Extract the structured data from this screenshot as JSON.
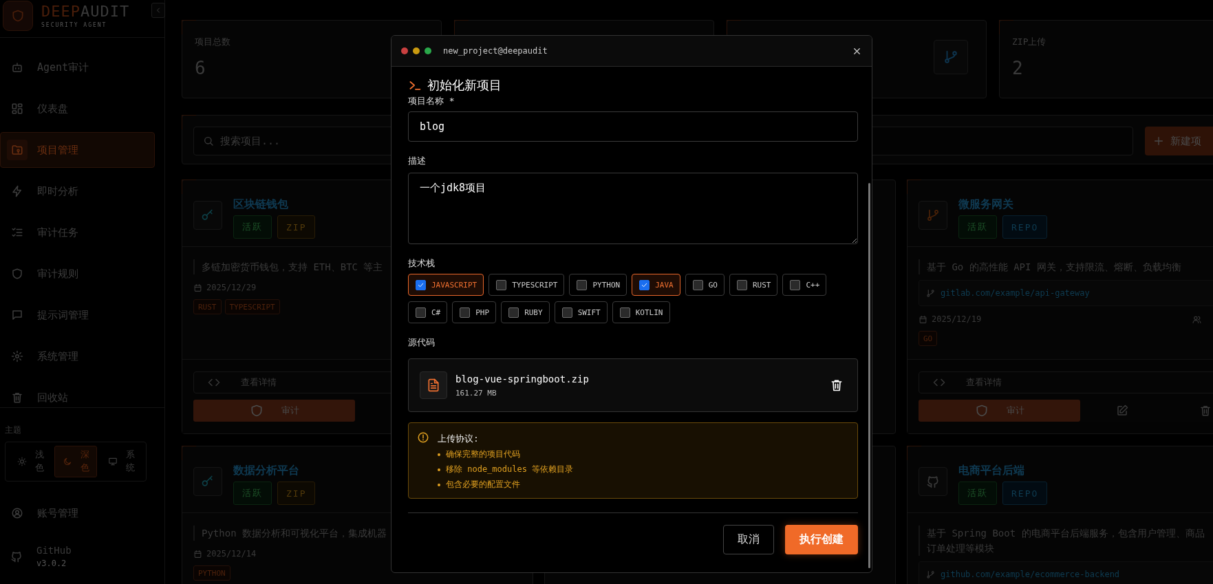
{
  "sidebar": {
    "brand_a": "DEEP",
    "brand_b": "AUDIT",
    "tagline": "SECURITY AGENT",
    "items": [
      {
        "label": "Agent审计",
        "selected": false
      },
      {
        "label": "仪表盘",
        "selected": false
      },
      {
        "label": "项目管理",
        "selected": true
      },
      {
        "label": "即时分析",
        "selected": false
      },
      {
        "label": "审计任务",
        "selected": false
      },
      {
        "label": "审计规则",
        "selected": false
      },
      {
        "label": "提示词管理",
        "selected": false
      },
      {
        "label": "系统管理",
        "selected": false
      },
      {
        "label": "回收站",
        "selected": false
      }
    ],
    "theme_label": "主题",
    "themes": [
      {
        "label": "浅色",
        "selected": false
      },
      {
        "label": "深色",
        "selected": true
      },
      {
        "label": "系统",
        "selected": false
      }
    ],
    "account": "账号管理",
    "github": "GitHub",
    "version": "v3.0.2"
  },
  "stats": [
    {
      "kind": "count",
      "label": "项目总数",
      "value": "6"
    },
    {
      "kind": "blank"
    },
    {
      "kind": "icon"
    },
    {
      "kind": "count",
      "label": "ZIP上传",
      "value": "2"
    }
  ],
  "search": {
    "placeholder": "搜索项目...",
    "button": "新建项"
  },
  "projects": [
    {
      "kind": "zip",
      "name": "区块链钱包",
      "status": "活跃",
      "type": "ZIP",
      "description_lines": [
        "多链加密货币钱包，支持 ETH、BTC 等主"
      ],
      "date": "2025/12/29",
      "tags": [
        "RUST",
        "TYPESCRIPT"
      ],
      "details": "查看详情",
      "audit": "审计"
    },
    {
      "kind": "covered"
    },
    {
      "kind": "repo",
      "name": "微服务网关",
      "status": "活跃",
      "type": "REPO",
      "description_lines": [
        "基于 Go 的高性能 API 网关，支持限流、熔断、负载均衡"
      ],
      "url": "gitlab.com/example/api-gateway",
      "date": "2025/12/19",
      "tags": [
        "GO"
      ],
      "details": "查看详情",
      "audit": "审计"
    },
    {
      "kind": "zip",
      "name": "数据分析平台",
      "status": "活跃",
      "type": "ZIP",
      "description_lines": [
        "Python 数据分析和可视化平台，集成机器"
      ],
      "date": "2025/12/14",
      "tags": [
        "PYTHON"
      ]
    },
    {
      "kind": "covered"
    },
    {
      "kind": "repo",
      "name": "电商平台后端",
      "status": "活跃",
      "type": "REPO",
      "description_lines": [
        "基于 Spring Boot 的电商平台后端服务，包含用户管理、商品",
        "订单处理等模块"
      ],
      "url": "github.com/example/ecommerce-backend"
    }
  ],
  "modal": {
    "title": "new_project@deepaudit",
    "heading": "初始化新项目",
    "name_label": "项目名称",
    "required_mark": "*",
    "name_value": "blog",
    "desc_label": "描述",
    "desc_value": "一个jdk8项目",
    "stack_label": "技术栈",
    "stack": [
      {
        "label": "JAVASCRIPT",
        "checked": true
      },
      {
        "label": "TYPESCRIPT",
        "checked": false
      },
      {
        "label": "PYTHON",
        "checked": false
      },
      {
        "label": "JAVA",
        "checked": true
      },
      {
        "label": "GO",
        "checked": false
      },
      {
        "label": "RUST",
        "checked": false
      },
      {
        "label": "C++",
        "checked": false
      },
      {
        "label": "C#",
        "checked": false
      },
      {
        "label": "PHP",
        "checked": false
      },
      {
        "label": "RUBY",
        "checked": false
      },
      {
        "label": "SWIFT",
        "checked": false
      },
      {
        "label": "KOTLIN",
        "checked": false
      }
    ],
    "source_label": "源代码",
    "file": {
      "name": "blog-vue-springboot.zip",
      "size": "161.27 MB"
    },
    "notice": {
      "title": "上传协议:",
      "items": [
        "确保完整的项目代码",
        "移除 node_modules 等依赖目录",
        "包含必要的配置文件"
      ]
    },
    "cancel": "取消",
    "submit": "执行创建"
  }
}
